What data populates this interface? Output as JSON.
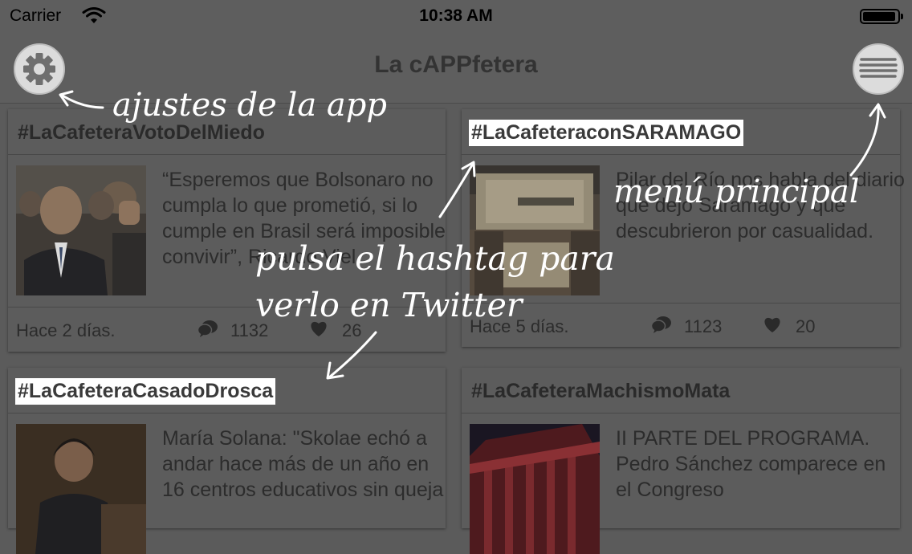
{
  "status_bar": {
    "carrier": "Carrier",
    "time": "10:38 AM"
  },
  "nav": {
    "title": "La cAPPfetera",
    "settings_icon": "gear-icon",
    "menu_icon": "hamburger-menu-icon"
  },
  "cards": [
    {
      "hashtag": "#LaCafeteraVotoDelMiedo",
      "text": "“Esperemos que Bolsonaro no cumpla lo que prometió, si lo cumple en Brasil será imposible convivir”, Ricardo Viel",
      "date": "Hace 2 días.",
      "comments": "1132",
      "likes": "26",
      "highlighted": false
    },
    {
      "hashtag": "#LaCafeteraconSARAMAGO",
      "text": "Pilar del Río nos habla del diario que dejó Saramago y que descubrieron por casualidad.",
      "date": "Hace 5 días.",
      "comments": "1123",
      "likes": "20",
      "highlighted": true
    },
    {
      "hashtag": "#LaCafeteraCasadoDrosca",
      "text": "María Solana: \"Skolae echó a andar hace más de un año en 16 centros educativos sin queja",
      "highlighted": true
    },
    {
      "hashtag": "#LaCafeteraMachismoMata",
      "text": "II PARTE DEL PROGRAMA. Pedro Sánchez comparece en el Congreso",
      "highlighted": false
    }
  ],
  "annotations": {
    "settings": "ajustes de la app",
    "menu": "menú principal",
    "hashtag_line1": "pulsa el hashtag para",
    "hashtag_line2": "verlo en Twitter"
  },
  "colors": {
    "overlay": "#5b5b5b",
    "highlight": "#ffffff",
    "annotation": "#ffffff"
  }
}
